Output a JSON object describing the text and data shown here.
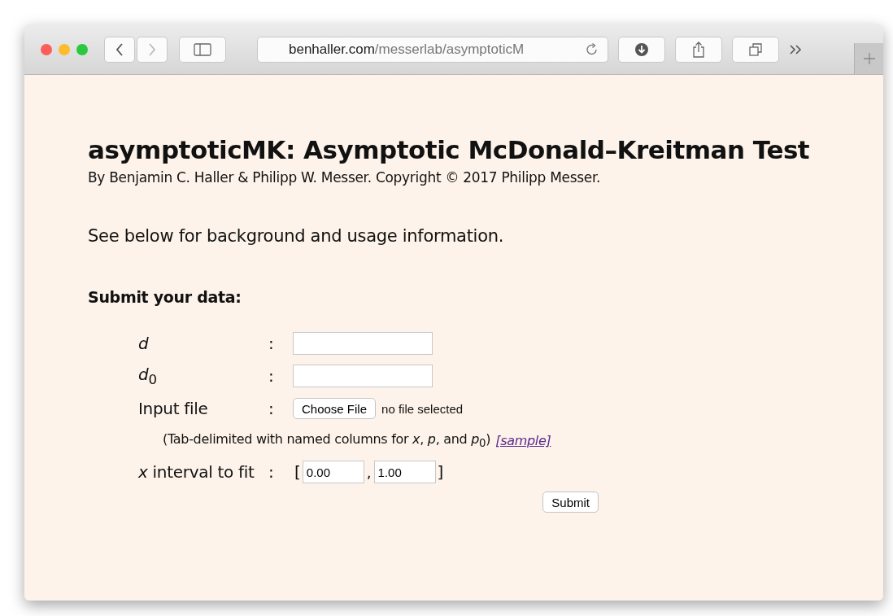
{
  "browser": {
    "url_host": "benhaller.com",
    "url_path": "/messerlab/asymptoticM"
  },
  "page": {
    "title": "asymptoticMK: Asymptotic McDonald–Kreitman Test",
    "byline": "By Benjamin C. Haller & Philipp W. Messer. Copyright © 2017 Philipp Messer.",
    "intro": "See below for background and usage information.",
    "section_heading": "Submit your data:",
    "form": {
      "rows": [
        {
          "kind": "text",
          "label": "*d*",
          "separator": ":",
          "value": ""
        },
        {
          "kind": "text",
          "label": "*d*$_{0}$",
          "separator": ":",
          "value": ""
        },
        {
          "kind": "file",
          "label": "Input file",
          "separator": ":",
          "button": "Choose File",
          "status": "no file selected"
        },
        {
          "kind": "interval",
          "label": "*x* interval to fit",
          "separator": ":",
          "open": "[",
          "low": "0.00",
          "comma": ",",
          "high": "1.00",
          "close": "]"
        }
      ],
      "note": {
        "text": "(Tab-delimited with named columns for *x*, *p*, and *p*$_{0}$)",
        "link": "[sample]"
      },
      "submit": "Submit"
    }
  }
}
